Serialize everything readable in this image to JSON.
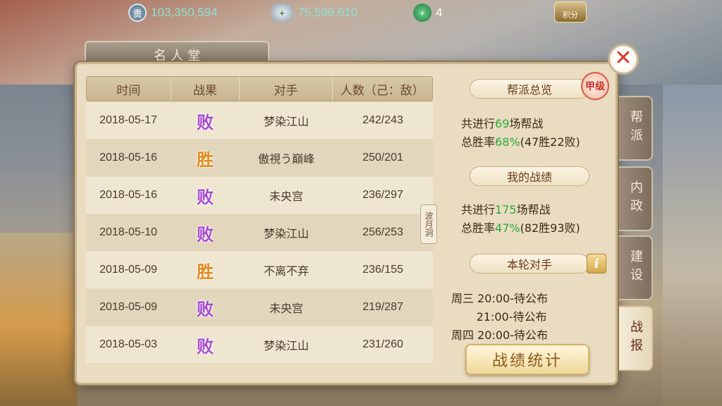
{
  "top_bar": {
    "coins": {
      "icon": "silver-coin-icon",
      "value": "103,350,594"
    },
    "ingots": {
      "icon": "silver-ingot-add-icon",
      "value": "75,599,610"
    },
    "jade": {
      "icon": "jade-add-icon",
      "value": "4"
    },
    "points_label": "积分"
  },
  "panel": {
    "title": "名人堂",
    "close_glyph": "✕"
  },
  "table": {
    "headers": [
      "时间",
      "战果",
      "对手",
      "人数（己：敌）"
    ],
    "rows": [
      {
        "date": "2018-05-17",
        "result": "败",
        "opponent": "梦染江山",
        "count": "242/243"
      },
      {
        "date": "2018-05-16",
        "result": "胜",
        "opponent": "傲視う巔峰",
        "count": "250/201"
      },
      {
        "date": "2018-05-16",
        "result": "败",
        "opponent": "未央宫",
        "count": "236/297"
      },
      {
        "date": "2018-05-10",
        "result": "败",
        "opponent": "梦染江山",
        "count": "256/253"
      },
      {
        "date": "2018-05-09",
        "result": "胜",
        "opponent": "不离不弃",
        "count": "236/155"
      },
      {
        "date": "2018-05-09",
        "result": "败",
        "opponent": "未央宫",
        "count": "219/287"
      },
      {
        "date": "2018-05-03",
        "result": "败",
        "opponent": "梦染江山",
        "count": "231/260"
      }
    ]
  },
  "divider_tab_label": "波月洞",
  "info": {
    "guild_overview": {
      "title": "帮派总览",
      "grade": "甲级",
      "line1_prefix": "共进行",
      "line1_value": "69",
      "line1_suffix": "场帮战",
      "line2_prefix": "总胜率",
      "line2_value": "68%",
      "line2_suffix": "(47胜22败)"
    },
    "my_record": {
      "title": "我的战绩",
      "line1_prefix": "共进行",
      "line1_value": "175",
      "line1_suffix": "场帮战",
      "line2_prefix": "总胜率",
      "line2_value": "47%",
      "line2_suffix": "(82胜93败)"
    },
    "opponents": {
      "title": "本轮对手",
      "info_glyph": "i",
      "schedule": [
        "周三 20:00-待公布",
        "       21:00-待公布",
        "周四 20:00-待公布"
      ]
    },
    "stats_button": "战绩统计"
  },
  "side_tabs": [
    "帮派",
    "内政",
    "建设",
    "战报"
  ],
  "colors": {
    "win": "#e08a1a",
    "lose": "#a64ad0",
    "highlight": "#2aa83a"
  }
}
